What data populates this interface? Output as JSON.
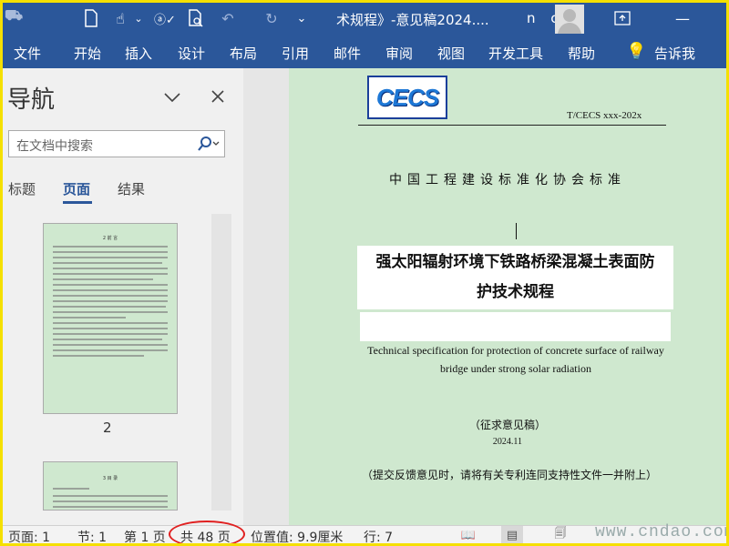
{
  "window": {
    "title": "术规程》-意见稿2024....",
    "user": "n c",
    "brand_color": "#2b579a"
  },
  "quick_access": [
    "file-icon",
    "touch-mode-icon",
    "dropdown-icon",
    "spelling-icon",
    "print-preview-icon",
    "undo-icon",
    "redo-icon",
    "customize-icon"
  ],
  "ribbon": {
    "tabs": [
      "文件",
      "开始",
      "插入",
      "设计",
      "布局",
      "引用",
      "邮件",
      "审阅",
      "视图",
      "开发工具",
      "帮助"
    ],
    "tell_me": "告诉我"
  },
  "nav_pane": {
    "title": "导航",
    "search_placeholder": "在文档中搜索",
    "tabs": [
      "标题",
      "页面",
      "结果"
    ],
    "active_tab": "页面",
    "thumbnails": [
      {
        "page": "2",
        "heading": "2 前 言"
      },
      {
        "page": "",
        "heading": "3 目 录"
      }
    ]
  },
  "document": {
    "standard_number": "T/CECS xxx-202x",
    "logo_text": "CECS",
    "association": "中国工程建设标准化协会标准",
    "title_cn_line1": "强太阳辐射环境下铁路桥梁混凝土表面防",
    "title_cn_line2": "护技术规程",
    "title_en_line1": "Technical specification for protection of concrete surface of railway",
    "title_en_line2": "bridge under strong solar radiation",
    "draft_label": "（征求意见稿）",
    "date": "2024.11",
    "note": "（提交反馈意见时，请将有关专利连同支持性文件一并附上）"
  },
  "status_bar": {
    "page": "页面: 1",
    "section": "节: 1",
    "page_of": "第 1 页",
    "total": "共 48 页",
    "position": "位置值: 9.9厘米",
    "line": "行: 7"
  },
  "watermark": "www.cndao.com"
}
